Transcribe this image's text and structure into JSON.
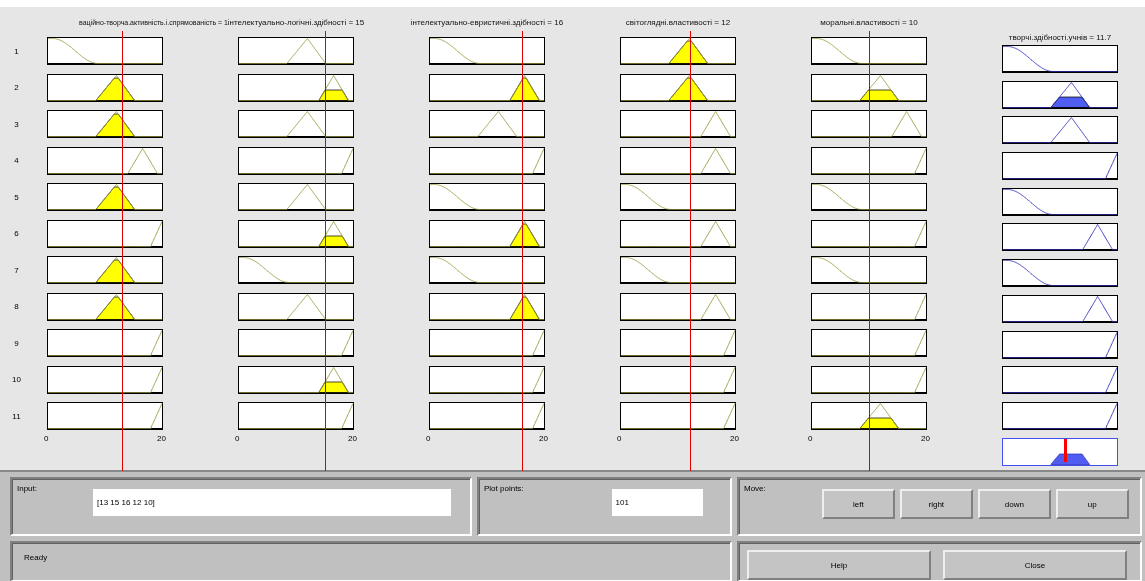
{
  "columns": [
    {
      "kind": "input",
      "title": "ваційно-творча.активність.і.спрямованість = 1",
      "level": 0.65,
      "axis": [
        "0",
        "20"
      ],
      "rows": [
        {
          "kind": "z",
          "fired": false
        },
        {
          "kind": "tri-mid",
          "fired": true,
          "clipped": false
        },
        {
          "kind": "tri-mid",
          "fired": true,
          "clipped": false
        },
        {
          "kind": "tri-high",
          "fired": false
        },
        {
          "kind": "tri-mid",
          "fired": true,
          "clipped": false
        },
        {
          "kind": "s",
          "fired": false
        },
        {
          "kind": "tri-mid",
          "fired": true,
          "clipped": false
        },
        {
          "kind": "tri-mid",
          "fired": true,
          "clipped": false
        },
        {
          "kind": "s",
          "fired": false
        },
        {
          "kind": "s",
          "fired": false
        },
        {
          "kind": "s",
          "fired": false
        }
      ]
    },
    {
      "kind": "input",
      "title": "інтелектуально-логічні.здібності = 15",
      "level": 0.75,
      "axis": [
        "0",
        "20"
      ],
      "rows": [
        {
          "kind": "tri-mid",
          "fired": false
        },
        {
          "kind": "tri-high",
          "fired": true,
          "clipped": true
        },
        {
          "kind": "tri-mid",
          "fired": false
        },
        {
          "kind": "s",
          "fired": false
        },
        {
          "kind": "tri-mid",
          "fired": false
        },
        {
          "kind": "tri-high",
          "fired": true,
          "clipped": true
        },
        {
          "kind": "z",
          "fired": false
        },
        {
          "kind": "tri-mid",
          "fired": false
        },
        {
          "kind": "s",
          "fired": false
        },
        {
          "kind": "tri-high",
          "fired": true,
          "clipped": true
        },
        {
          "kind": "s",
          "fired": false
        }
      ]
    },
    {
      "kind": "input",
      "title": "інтелектуально-евристичні.здібності = 16",
      "level": 0.8,
      "axis": [
        "0",
        "20"
      ],
      "rows": [
        {
          "kind": "z",
          "fired": false
        },
        {
          "kind": "tri-high",
          "fired": true,
          "clipped": false
        },
        {
          "kind": "tri-mid",
          "fired": false
        },
        {
          "kind": "s",
          "fired": false
        },
        {
          "kind": "z",
          "fired": false
        },
        {
          "kind": "tri-high",
          "fired": true,
          "clipped": false
        },
        {
          "kind": "z",
          "fired": false
        },
        {
          "kind": "tri-high",
          "fired": true,
          "clipped": false
        },
        {
          "kind": "s",
          "fired": false
        },
        {
          "kind": "s",
          "fired": false
        },
        {
          "kind": "s",
          "fired": false
        }
      ]
    },
    {
      "kind": "input",
      "title": "світоглядні.властивості = 12",
      "level": 0.6,
      "axis": [
        "0",
        "20"
      ],
      "rows": [
        {
          "kind": "tri-mid",
          "fired": true,
          "clipped": false
        },
        {
          "kind": "tri-mid",
          "fired": true,
          "clipped": false
        },
        {
          "kind": "tri-high",
          "fired": false
        },
        {
          "kind": "tri-high",
          "fired": false
        },
        {
          "kind": "z",
          "fired": false
        },
        {
          "kind": "tri-high",
          "fired": false
        },
        {
          "kind": "z",
          "fired": false
        },
        {
          "kind": "tri-high",
          "fired": false
        },
        {
          "kind": "s",
          "fired": false
        },
        {
          "kind": "s",
          "fired": false
        },
        {
          "kind": "s",
          "fired": false
        }
      ]
    },
    {
      "kind": "input",
      "title": "моральні.властивості = 10",
      "level": 0.5,
      "axis": [
        "0",
        "20"
      ],
      "rows": [
        {
          "kind": "z",
          "fired": false
        },
        {
          "kind": "tri-mid",
          "fired": true,
          "clipped": true
        },
        {
          "kind": "tri-high",
          "fired": false
        },
        {
          "kind": "s",
          "fired": false
        },
        {
          "kind": "z",
          "fired": false
        },
        {
          "kind": "s",
          "fired": false
        },
        {
          "kind": "z",
          "fired": false
        },
        {
          "kind": "s",
          "fired": false
        },
        {
          "kind": "s",
          "fired": false
        },
        {
          "kind": "s",
          "fired": false
        },
        {
          "kind": "tri-mid",
          "fired": true,
          "clipped": true
        }
      ]
    },
    {
      "kind": "output",
      "title": "творчі.здібності.учнів = 11.7",
      "level": 0.55,
      "rows": [
        {
          "kind": "z",
          "fired": false
        },
        {
          "kind": "tri-mid",
          "fired": true,
          "clipped": true
        },
        {
          "kind": "tri-mid",
          "fired": false
        },
        {
          "kind": "s",
          "fired": false
        },
        {
          "kind": "z",
          "fired": false
        },
        {
          "kind": "tri-high",
          "fired": false
        },
        {
          "kind": "z",
          "fired": false
        },
        {
          "kind": "tri-high",
          "fired": false
        },
        {
          "kind": "s",
          "fired": false
        },
        {
          "kind": "s",
          "fired": false
        },
        {
          "kind": "s",
          "fired": false
        }
      ]
    }
  ],
  "row_numbers": [
    "1",
    "2",
    "3",
    "4",
    "5",
    "6",
    "7",
    "8",
    "9",
    "10",
    "11"
  ],
  "input": {
    "label": "Input:",
    "value": "[13 15 16 12 10]"
  },
  "plot_points": {
    "label": "Plot points:",
    "value": "101"
  },
  "move": {
    "label": "Move:",
    "buttons": [
      "left",
      "right",
      "down",
      "up"
    ]
  },
  "status": "Ready",
  "buttons": [
    "Help",
    "Close"
  ]
}
